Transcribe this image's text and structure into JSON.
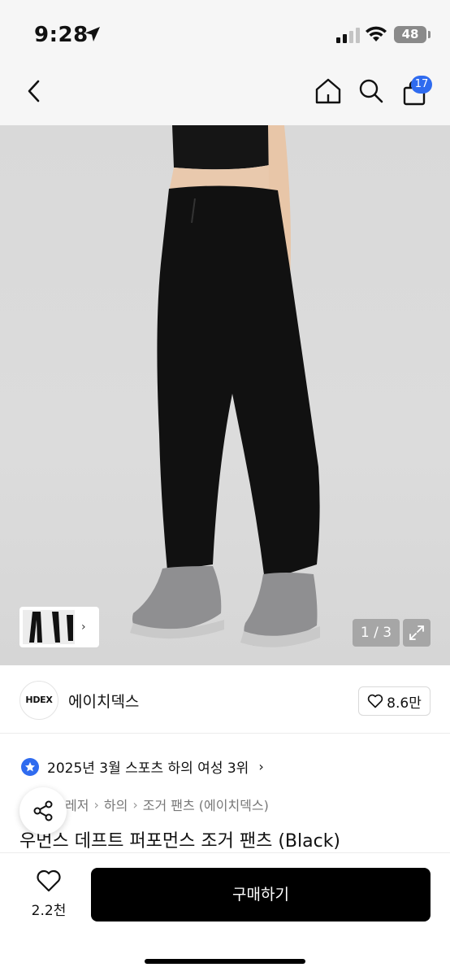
{
  "status": {
    "time": "9:28",
    "battery": "48"
  },
  "nav": {
    "cart_count": "17"
  },
  "gallery": {
    "page_counter": "1 / 3"
  },
  "brand": {
    "logo_text": "HDEX",
    "name": "에이치덱스",
    "likes": "8.6만"
  },
  "ranking": {
    "text": "2025년 3월 스포츠 하의 여성 3위"
  },
  "breadcrumb": [
    "레저",
    "하의",
    "조거 팬츠 (에이치덱스)"
  ],
  "product": {
    "title": "우먼스 데프트 퍼포먼스 조거 팬츠 (Black)"
  },
  "bottom": {
    "wish_count": "2.2천",
    "buy_label": "구매하기"
  },
  "icons": {
    "back": "chevron-left-icon",
    "home": "home-icon",
    "search": "search-icon",
    "cart": "shopping-bag-icon",
    "share": "share-icon",
    "heart": "heart-icon",
    "expand": "expand-icon",
    "rank": "star-badge-icon"
  },
  "colors": {
    "accent": "#2f6bef",
    "buy_button": "#000000"
  }
}
